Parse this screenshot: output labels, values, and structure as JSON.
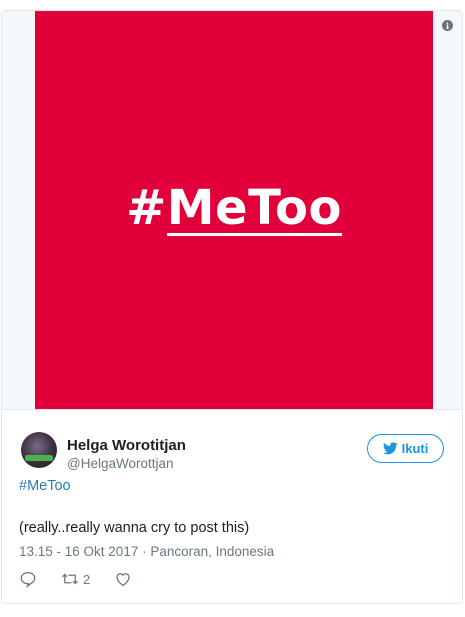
{
  "media": {
    "graphic_hash": "#",
    "graphic_word": "MeToo",
    "background_color": "#e1003a",
    "info_icon": "info-icon"
  },
  "author": {
    "name": "Helga Worotitjan",
    "handle": "@HelgaWorottjan",
    "avatar_icon": "avatar"
  },
  "follow_button": {
    "label": "Ikuti",
    "icon": "twitter-bird-icon"
  },
  "tweet": {
    "hashtag": "#MeToo",
    "text": "(really..really wanna cry to post this)"
  },
  "meta": {
    "timestamp": "13.15 - 16 Okt 2017",
    "separator": " · ",
    "location": "Pancoran, Indonesia"
  },
  "actions": {
    "reply_icon": "reply-icon",
    "retweet_icon": "retweet-icon",
    "retweet_count": "2",
    "like_icon": "heart-icon"
  },
  "colors": {
    "link": "#2b7bb9",
    "accent": "#1b95e0",
    "muted": "#697882"
  }
}
